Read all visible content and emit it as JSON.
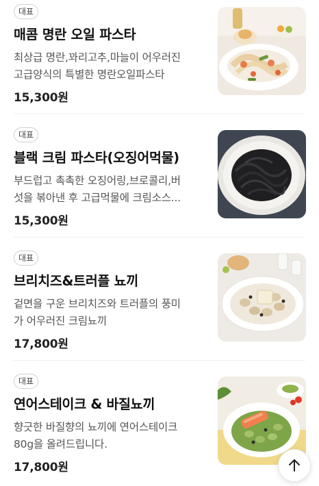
{
  "menu_items": [
    {
      "badge": "대표",
      "title": "매콤 명란 오일 파스타",
      "desc_line1": "최상급 명란,꽈리고추,마늘이 어우러진",
      "desc_line2": "고급양식의 특별한 명란오일파스타",
      "price": "15,300원",
      "image_icon": "spicy-pollock-roe-oil-pasta-photo"
    },
    {
      "badge": "대표",
      "title": "블랙 크림 파스타(오징어먹물)",
      "desc_line1": "부드럽고 촉촉한 오징어링,브로콜리,버",
      "desc_line2": "섯을 볶아낸 후 고급먹물에 크림소스...",
      "price": "15,300원",
      "image_icon": "squid-ink-cream-pasta-photo"
    },
    {
      "badge": "대표",
      "title": "브리치즈&트러플 뇨끼",
      "desc_line1": "겉면을 구운 브리치즈와 트러플의 풍미",
      "desc_line2": "가 어우러진 크림뇨끼",
      "price": "17,800원",
      "image_icon": "brie-truffle-gnocchi-photo"
    },
    {
      "badge": "대표",
      "title": "연어스테이크 & 바질뇨끼",
      "desc_line1": "향긋한 바질향의 뇨끼에 연어스테이크",
      "desc_line2": "80g을 올려드립니다.",
      "price": "17,800원",
      "image_icon": "salmon-steak-basil-gnocchi-photo"
    }
  ],
  "scroll_top_icon": "arrow-up-icon",
  "colors": {
    "text_primary": "#111111",
    "text_secondary": "#555555",
    "badge_border": "#cfcfcf",
    "divider": "#eeeeee"
  }
}
